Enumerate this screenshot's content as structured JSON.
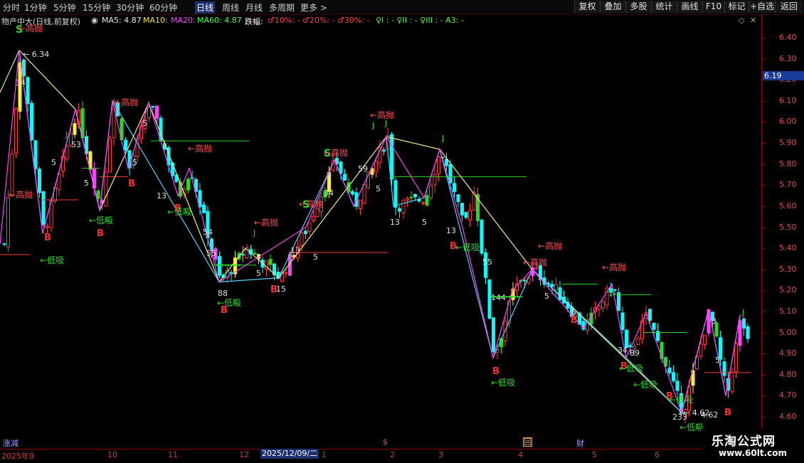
{
  "toolbar": {
    "periods": [
      "分时",
      "1分钟",
      "5分钟",
      "15分钟",
      "30分钟",
      "60分钟",
      "日线",
      "周线",
      "月线",
      "多周期",
      "更多 >"
    ],
    "active_period": "日线",
    "buttons": [
      "复权",
      "叠加",
      "多股",
      "统计",
      "画线",
      "F10",
      "标记",
      "+自选",
      "返回"
    ]
  },
  "info": {
    "stock": "物产中大(日线,前复权)",
    "ma5": "MA5: 4.87",
    "ma10": "MA10:",
    "ma20": "MA20:",
    "ma60": "MA60: 4.87",
    "limit_label": "跌幅:",
    "limit_values": "♂10%: -  ♂20%: -  ♂30%: -",
    "indicators": "♀I : -  ♀II : -  ♀III : -  A3: -"
  },
  "price_axis": {
    "ticks": [
      "6.40",
      "6.30",
      "6.20",
      "6.10",
      "6.00",
      "5.90",
      "5.80",
      "5.70",
      "5.60",
      "5.50",
      "5.40",
      "5.30",
      "5.20",
      "5.10",
      "5.00",
      "4.90",
      "4.80",
      "4.70",
      "4.60"
    ],
    "current_price": "6.19",
    "max_label": "6.34",
    "min_label": "4.62"
  },
  "time_axis": {
    "labels": [
      "2025年9",
      "10",
      "11",
      "12",
      "1",
      "2",
      "3",
      "4",
      "5",
      "6"
    ],
    "active_date": "2025/12/09/二",
    "flags": [
      "涨减",
      "$",
      "回",
      "财"
    ]
  },
  "annotations": {
    "high_sell": "←高抛",
    "low_buy": "←低吸",
    "buy": "B",
    "sell": "S",
    "j": "J"
  },
  "colors": {
    "up": "#ff3b3b",
    "down": "#00ffff",
    "buy": "#ff2a2a",
    "sell": "#22dd22",
    "zigzag_yellow": "#f0f080",
    "zigzag_cyan": "#55d0ff",
    "zigzag_magenta": "#ff40ff"
  },
  "watermark": {
    "name": "乐淘公式网",
    "url": "www.60lt.com"
  }
}
